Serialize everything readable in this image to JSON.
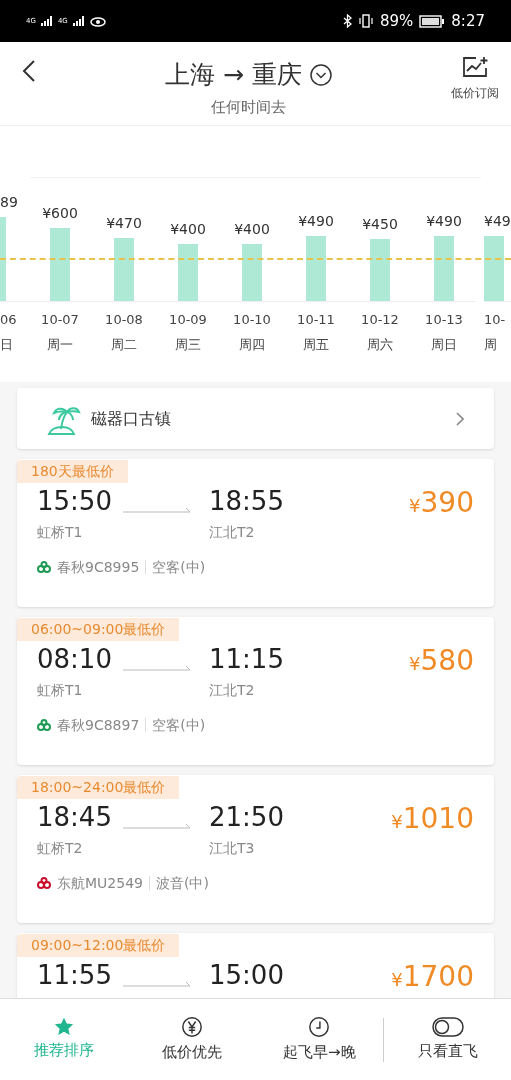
{
  "status_bar": {
    "signal_1": "4G",
    "signal_2": "4G",
    "battery": "89%",
    "time": "8:27"
  },
  "header": {
    "from": "上海",
    "arrow": "→",
    "to": "重庆",
    "subtitle": "任何时间去",
    "subscribe": "低价订阅"
  },
  "days": [
    {
      "price": "89",
      "date": "06",
      "weekday": "日"
    },
    {
      "price": "¥600",
      "date": "10-07",
      "weekday": "周一"
    },
    {
      "price": "¥470",
      "date": "10-08",
      "weekday": "周二"
    },
    {
      "price": "¥400",
      "date": "10-09",
      "weekday": "周三"
    },
    {
      "price": "¥400",
      "date": "10-10",
      "weekday": "周四"
    },
    {
      "price": "¥490",
      "date": "10-11",
      "weekday": "周五"
    },
    {
      "price": "¥450",
      "date": "10-12",
      "weekday": "周六"
    },
    {
      "price": "¥490",
      "date": "10-13",
      "weekday": "周日"
    },
    {
      "price": "¥49",
      "date": "10-",
      "weekday": "周"
    }
  ],
  "destination": {
    "name": "磁器口古镇"
  },
  "flights": [
    {
      "tag": "180天最低价",
      "depart": "15:50",
      "arrive": "18:55",
      "from": "虹桥T1",
      "to": "江北T2",
      "price": "390",
      "currency": "¥",
      "airline": "春秋9C8995",
      "aircraft": "空客(中)",
      "color": "#1f9a55"
    },
    {
      "tag": "06:00~09:00最低价",
      "depart": "08:10",
      "arrive": "11:15",
      "from": "虹桥T1",
      "to": "江北T2",
      "price": "580",
      "currency": "¥",
      "airline": "春秋9C8897",
      "aircraft": "空客(中)",
      "color": "#1f9a55"
    },
    {
      "tag": "18:00~24:00最低价",
      "depart": "18:45",
      "arrive": "21:50",
      "from": "虹桥T2",
      "to": "江北T3",
      "price": "1010",
      "currency": "¥",
      "airline": "东航MU2549",
      "aircraft": "波音(中)",
      "color": "#c8102e"
    },
    {
      "tag": "09:00~12:00最低价",
      "depart": "11:55",
      "arrive": "15:00",
      "price": "1700",
      "currency": "¥"
    }
  ],
  "bottom_bar": [
    {
      "kind": "star",
      "label": "推荐排序",
      "selected": true
    },
    {
      "kind": "yen",
      "label": "低价优先",
      "selected": false
    },
    {
      "kind": "clock",
      "label": "起飞早→晚",
      "selected": false
    },
    {
      "kind": "toggle",
      "label": "只看直飞",
      "on": false
    }
  ]
}
